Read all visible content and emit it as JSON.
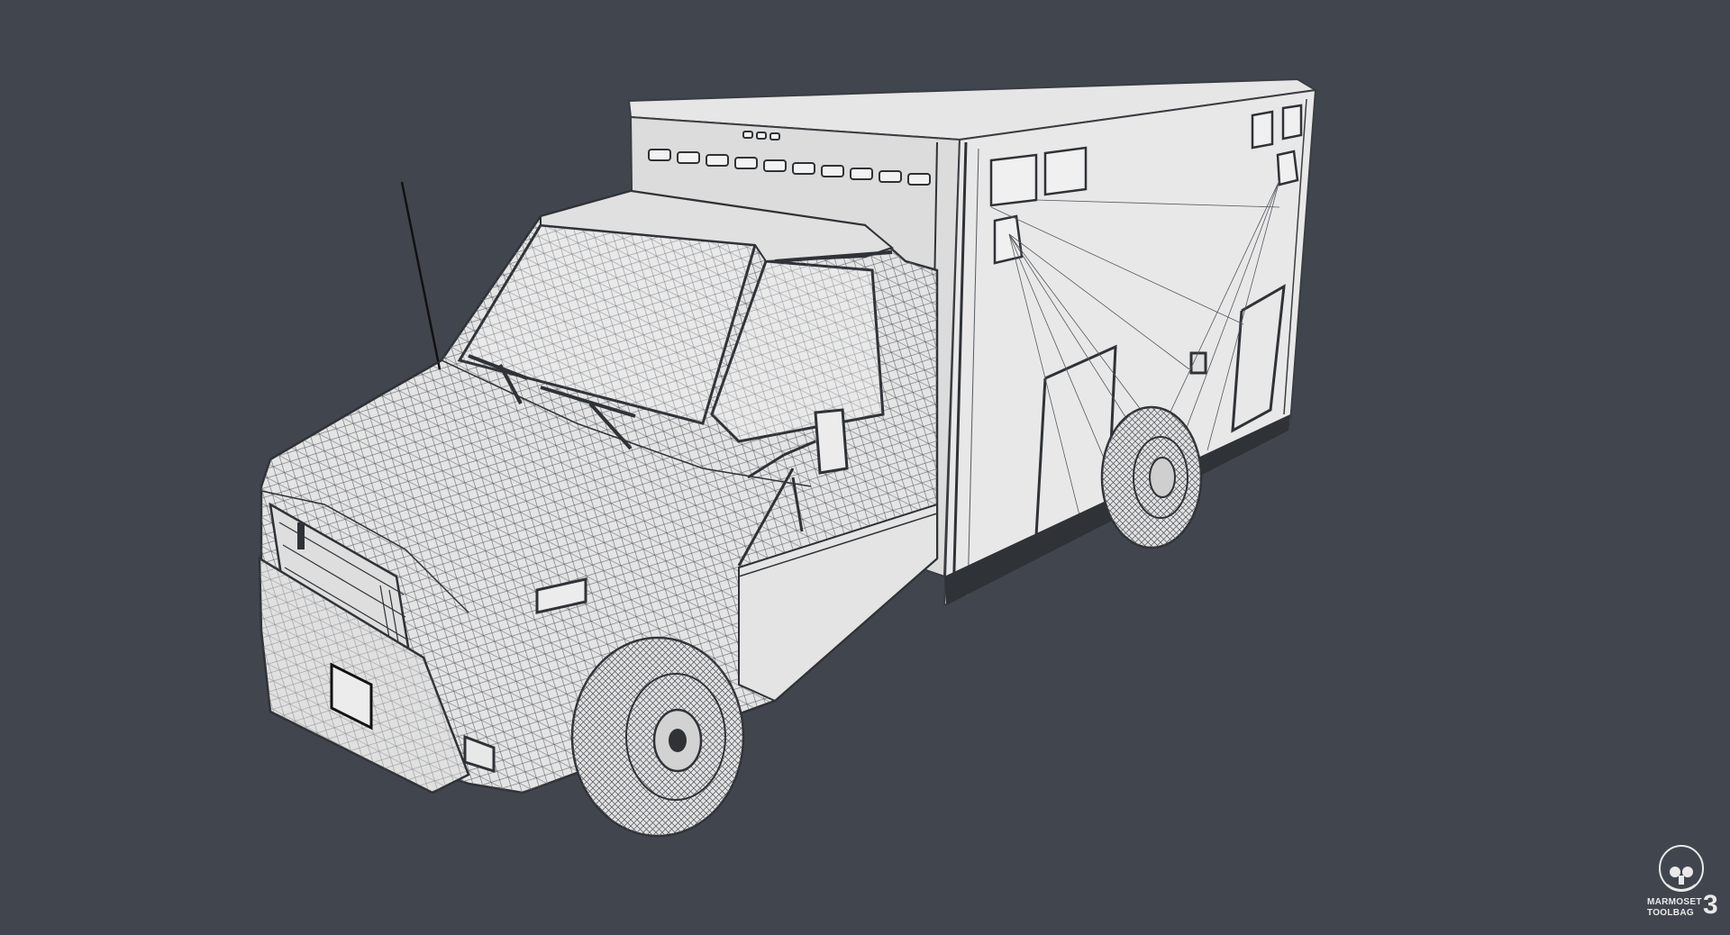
{
  "viewport": {
    "background": "#41464e",
    "subject": "ambulance-wireframe-model"
  },
  "watermark": {
    "line1": "MARMOSET",
    "line2": "TOOLBAG",
    "version": "3",
    "color": "#e9e9e9"
  }
}
